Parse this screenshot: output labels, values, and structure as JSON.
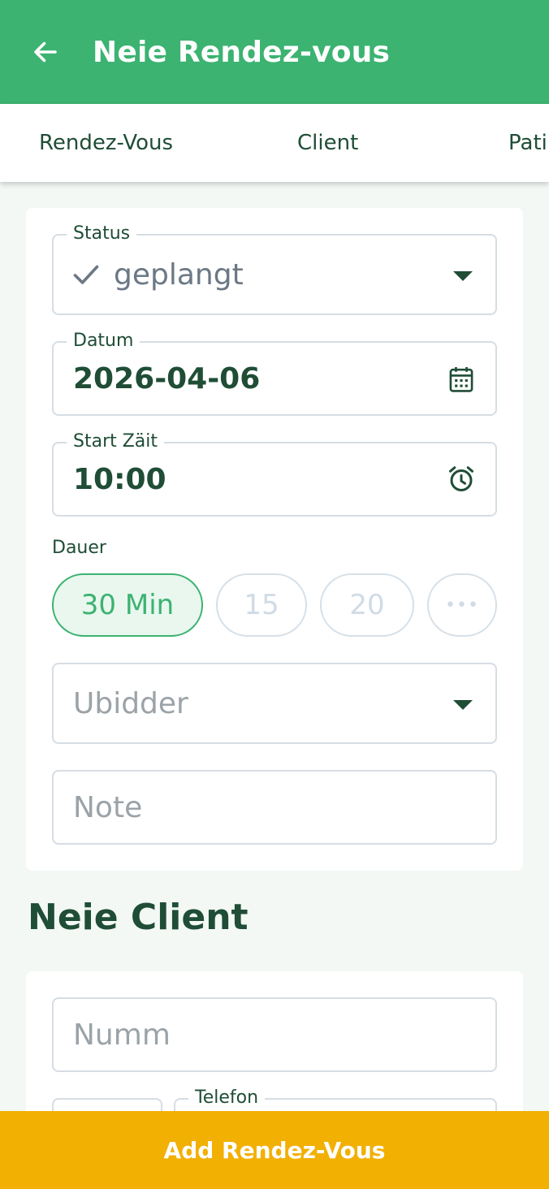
{
  "header": {
    "title": "Neie Rendez-vous",
    "back_icon": "arrow-left-icon"
  },
  "tabs": [
    {
      "label": "Rendez-Vous"
    },
    {
      "label": "Client"
    },
    {
      "label": "Pati"
    }
  ],
  "appointment": {
    "status": {
      "label": "Status",
      "value": "geplangt",
      "icon": "check-icon"
    },
    "date": {
      "label": "Datum",
      "value": "2026-04-06",
      "icon": "calendar-icon"
    },
    "start_time": {
      "label": "Start Zäit",
      "value": "10:00",
      "icon": "alarm-clock-icon"
    },
    "duration": {
      "label": "Dauer",
      "options": [
        {
          "label": "30 Min",
          "selected": true
        },
        {
          "label": "15",
          "selected": false
        },
        {
          "label": "20",
          "selected": false
        },
        {
          "label": "•••",
          "selected": false
        }
      ]
    },
    "provider": {
      "placeholder": "Ubidder"
    },
    "note": {
      "placeholder": "Note"
    }
  },
  "new_client": {
    "title": "Neie Client",
    "name": {
      "placeholder": "Numm"
    },
    "phone": {
      "label": "Telefon"
    }
  },
  "submit": {
    "label": "Add Rendez-Vous"
  },
  "colors": {
    "primary": "#3cb371",
    "accent": "#f2b003",
    "text": "#1f4d36",
    "background": "#f3f8f4"
  }
}
